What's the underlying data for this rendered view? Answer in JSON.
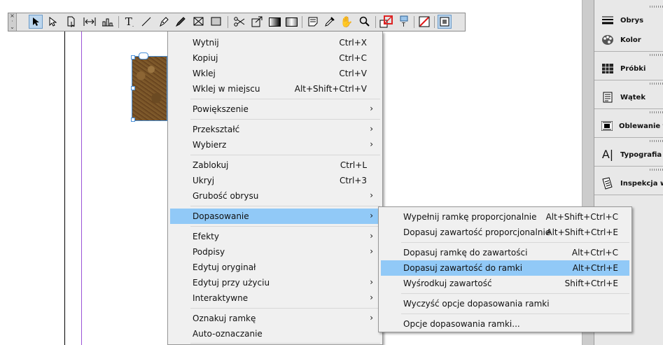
{
  "context_menu": {
    "items": [
      {
        "label": "Wytnij",
        "shortcut": "Ctrl+X"
      },
      {
        "label": "Kopiuj",
        "shortcut": "Ctrl+C"
      },
      {
        "label": "Wklej",
        "shortcut": "Ctrl+V"
      },
      {
        "label": "Wklej w miejscu",
        "shortcut": "Alt+Shift+Ctrl+V"
      },
      {
        "label": "Powiększenie",
        "submenu": true
      },
      {
        "label": "Przekształć",
        "submenu": true
      },
      {
        "label": "Wybierz",
        "submenu": true
      },
      {
        "label": "Zablokuj",
        "shortcut": "Ctrl+L"
      },
      {
        "label": "Ukryj",
        "shortcut": "Ctrl+3"
      },
      {
        "label": "Grubość obrysu",
        "submenu": true
      },
      {
        "label": "Dopasowanie",
        "submenu": true,
        "highlighted": true
      },
      {
        "label": "Efekty",
        "submenu": true
      },
      {
        "label": "Podpisy",
        "submenu": true
      },
      {
        "label": "Edytuj oryginał"
      },
      {
        "label": "Edytuj przy użyciu",
        "submenu": true
      },
      {
        "label": "Interaktywne",
        "submenu": true
      },
      {
        "label": "Oznakuj ramkę",
        "submenu": true
      },
      {
        "label": "Auto-oznaczanie"
      }
    ],
    "submenu_arrow": "›"
  },
  "fitting_submenu": {
    "items": [
      {
        "label": "Wypełnij ramkę proporcjonalnie",
        "shortcut": "Alt+Shift+Ctrl+C"
      },
      {
        "label": "Dopasuj zawartość proporcjonalnie",
        "shortcut": "Alt+Shift+Ctrl+E"
      },
      {
        "label": "Dopasuj ramkę do zawartości",
        "shortcut": "Alt+Ctrl+C"
      },
      {
        "label": "Dopasuj zawartość do ramki",
        "shortcut": "Alt+Ctrl+E",
        "highlighted": true
      },
      {
        "label": "Wyśrodkuj zawartość",
        "shortcut": "Shift+Ctrl+E"
      },
      {
        "label": "Wyczyść opcje dopasowania ramki"
      },
      {
        "label": "Opcje dopasowania ramki..."
      }
    ]
  },
  "panel": {
    "items": [
      {
        "label": "Obrys",
        "icon": "stroke-icon"
      },
      {
        "label": "Kolor",
        "icon": "color-palette-icon"
      },
      {
        "label": "Próbki",
        "icon": "swatches-icon"
      },
      {
        "label": "Wątek",
        "icon": "thread-icon"
      },
      {
        "label": "Oblewanie tek",
        "icon": "text-wrap-icon"
      },
      {
        "label": "Typografia",
        "icon": "glyphs-icon"
      },
      {
        "label": "Inspekcja wst",
        "icon": "preflight-icon"
      }
    ]
  },
  "toolbar": {
    "tools": [
      "selection-tool-icon",
      "direct-selection-tool-icon",
      "page-tool-icon",
      "gap-tool-icon",
      "content-collector-icon",
      "type-tool-icon",
      "line-tool-icon",
      "pen-tool-icon",
      "pencil-tool-icon",
      "rectangle-frame-tool-icon",
      "rectangle-tool-icon",
      "scissors-tool-icon",
      "free-transform-tool-icon",
      "gradient-swatch-tool-icon",
      "gradient-feather-tool-icon",
      "note-tool-icon",
      "eyedropper-tool-icon",
      "hand-tool-icon",
      "zoom-tool-icon",
      "fill-stroke-swap-icon",
      "formatting-affects-container-icon",
      "apply-none-icon",
      "normal-view-mode-icon"
    ],
    "selected_tool": "selection-tool-icon"
  },
  "colors": {
    "highlight": "#91c9f7",
    "menu_bg": "#f0f0f0",
    "guide": "#9b54d6",
    "selection": "#4a90d9"
  }
}
